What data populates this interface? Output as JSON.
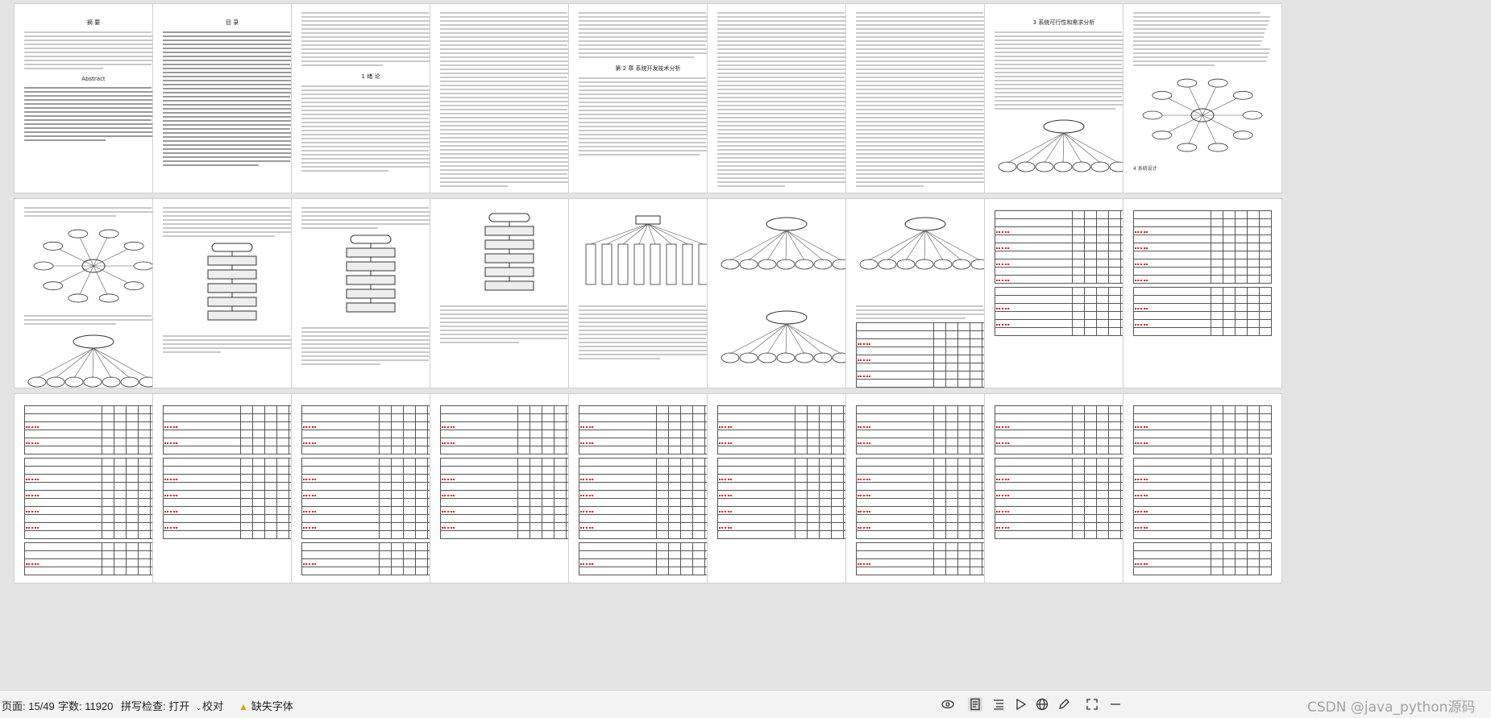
{
  "status": {
    "page_label": "页面: 15/49",
    "word_count": "字数: 11920",
    "spell_check": "拼写检查: 打开",
    "proofread": "校对",
    "missing_font": "缺失字体",
    "watermark": "CSDN @java_python源码"
  },
  "pages_row1": [
    {
      "title": "摘 要",
      "subtitle": "Abstract"
    },
    {
      "title": "目 录"
    },
    {
      "title": ""
    },
    {
      "title": ""
    },
    {
      "title": ""
    },
    {
      "title": ""
    },
    {
      "title": ""
    },
    {
      "title": ""
    },
    {
      "title": ""
    }
  ],
  "headings": {
    "p3_chapter": "1  绪 论",
    "p5_chapter": "第 2 章  系统开发技术分析",
    "p8_chapter": "3 系统可行性和需求分析",
    "p9_chapter": "4 系统设计"
  },
  "icons": [
    "eye-icon",
    "page-view-icon",
    "outline-icon",
    "play-icon",
    "globe-icon",
    "pen-icon",
    "fit-icon",
    "zoom-out-icon"
  ]
}
